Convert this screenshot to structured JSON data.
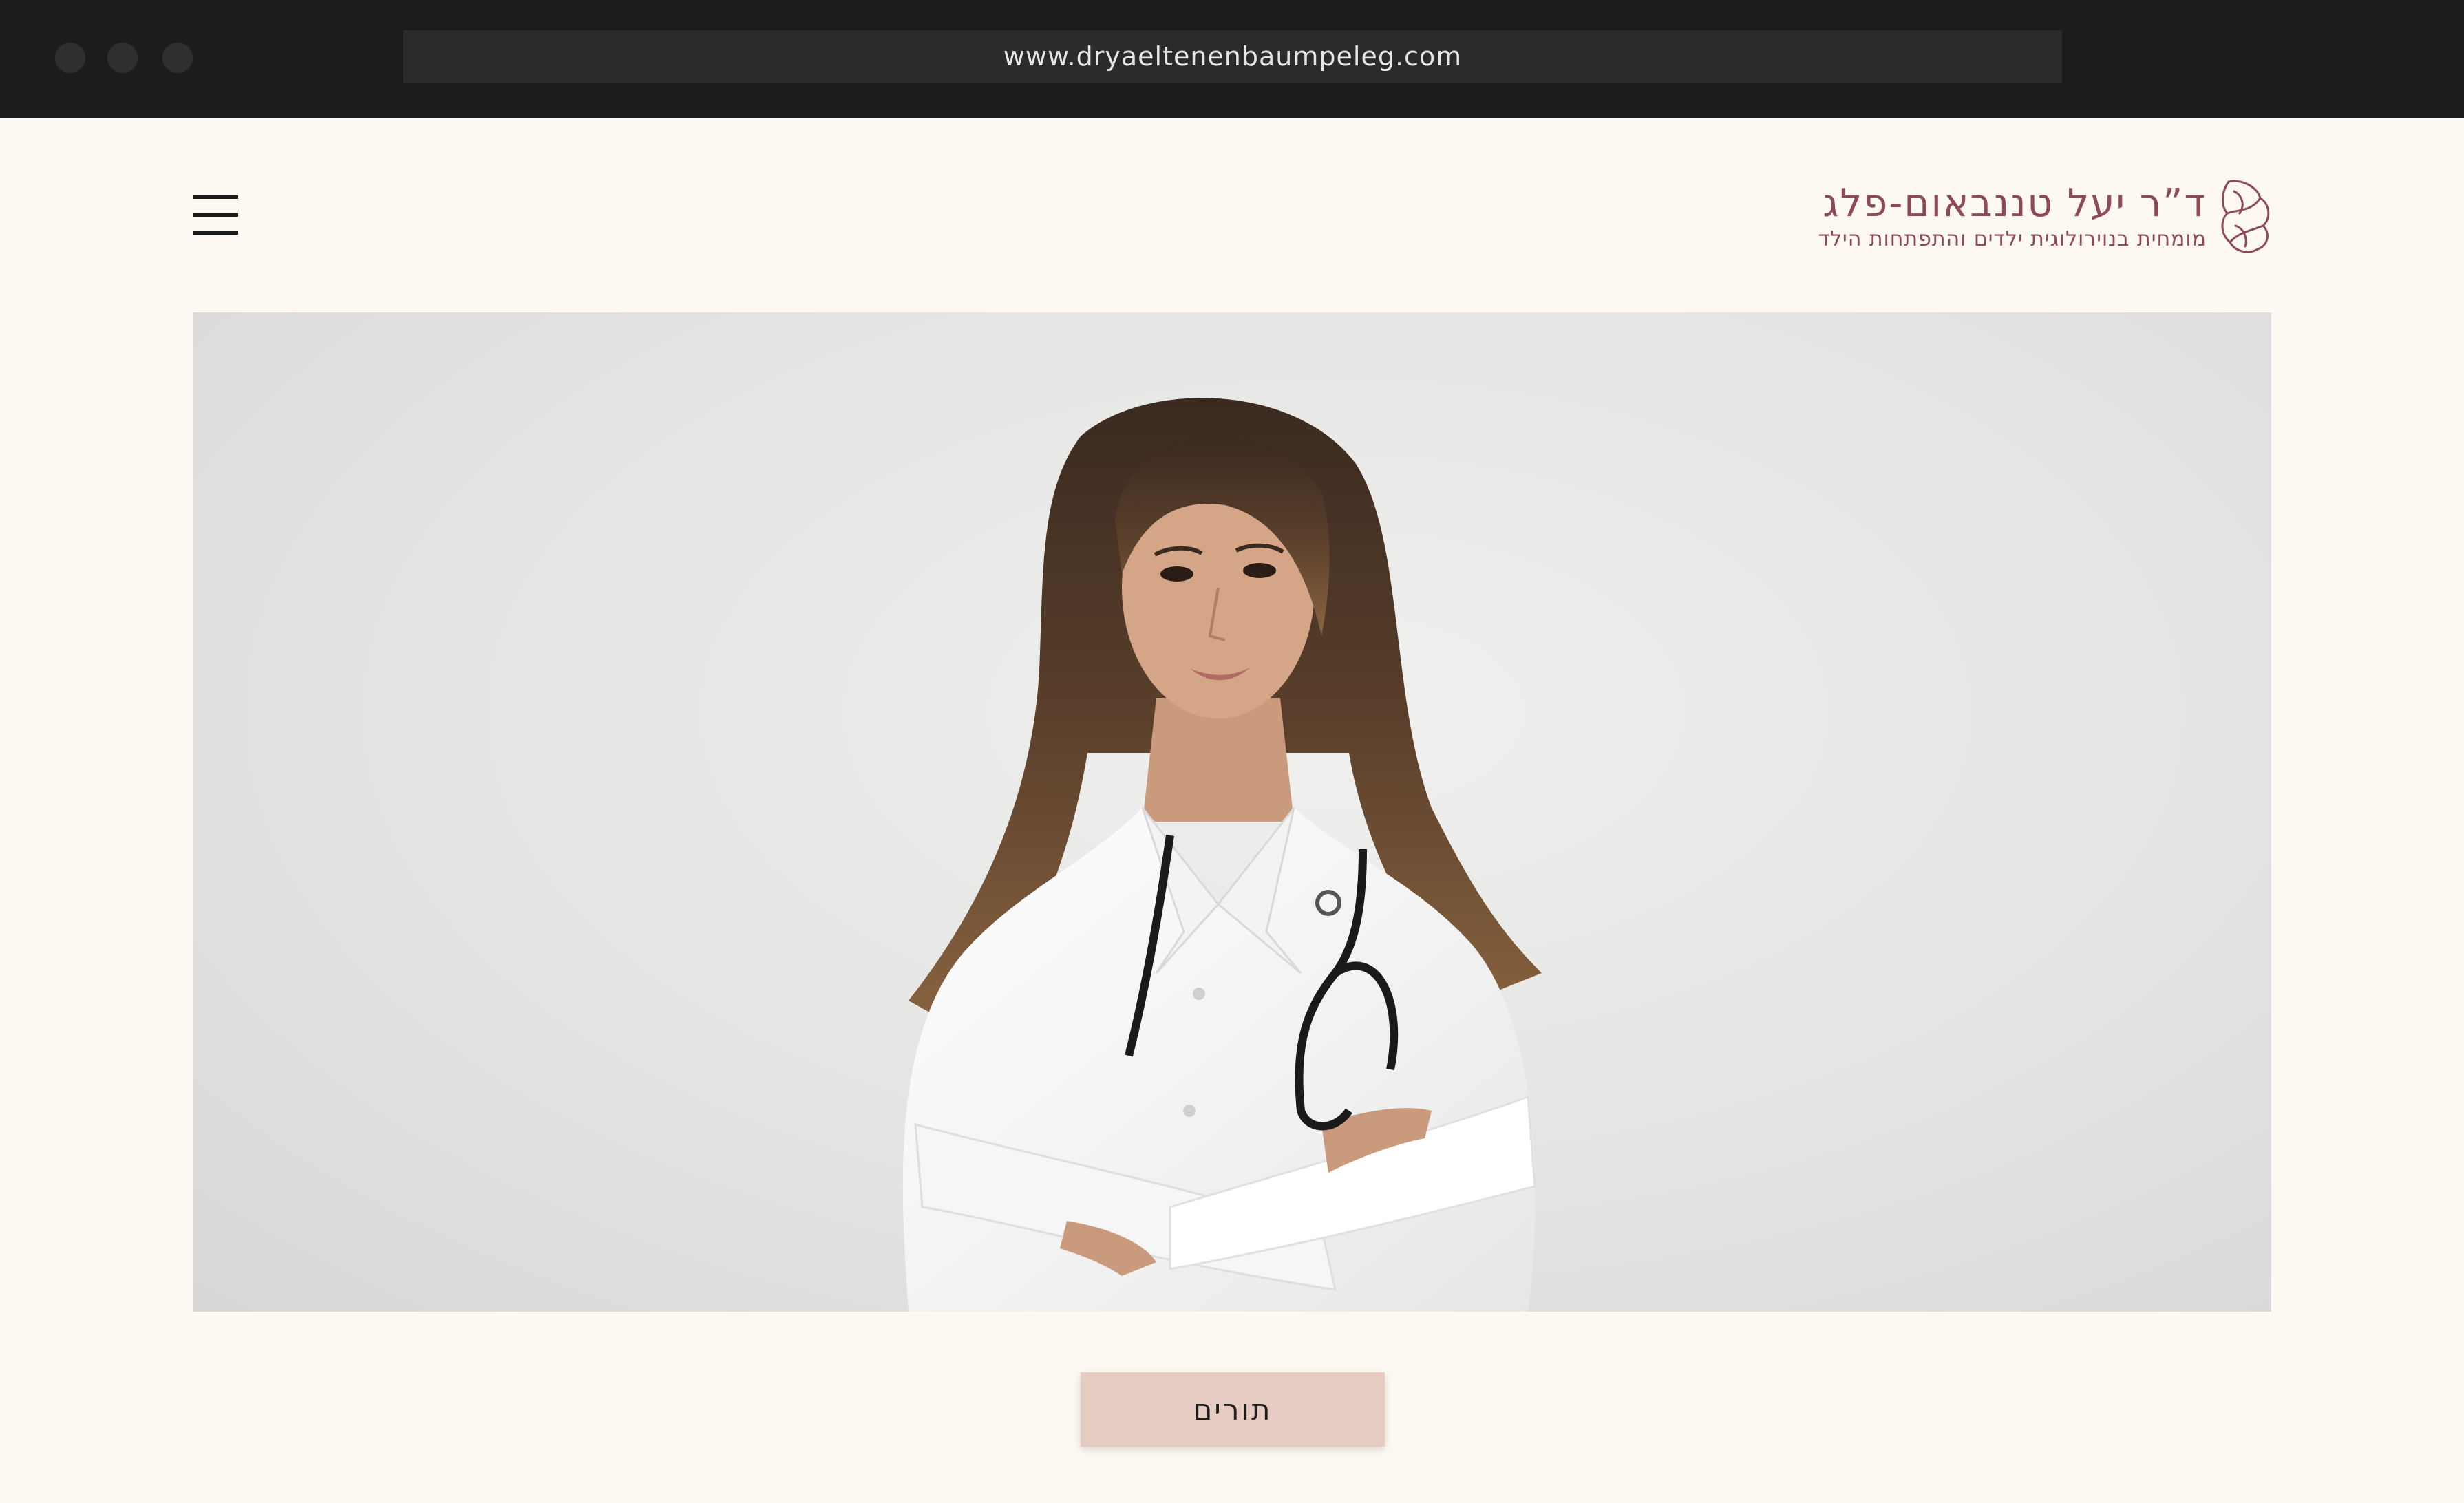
{
  "browser": {
    "url": "www.dryaeltenenbaumpeleg.com"
  },
  "header": {
    "menu_icon": "hamburger-menu-icon",
    "logo": {
      "title": "ד”ר יעל טננבאום-פלג",
      "subtitle": "מומחית בנוירולוגית ילדים והתפתחות הילד",
      "mark_icon": "brain-outline-icon"
    }
  },
  "hero": {
    "image": "doctor-portrait"
  },
  "cta": {
    "label": "תורים"
  },
  "colors": {
    "background": "#fdf8f1",
    "brand": "#8e4a52",
    "button": "#e6cbc3",
    "chrome": "#1c1c1c"
  }
}
